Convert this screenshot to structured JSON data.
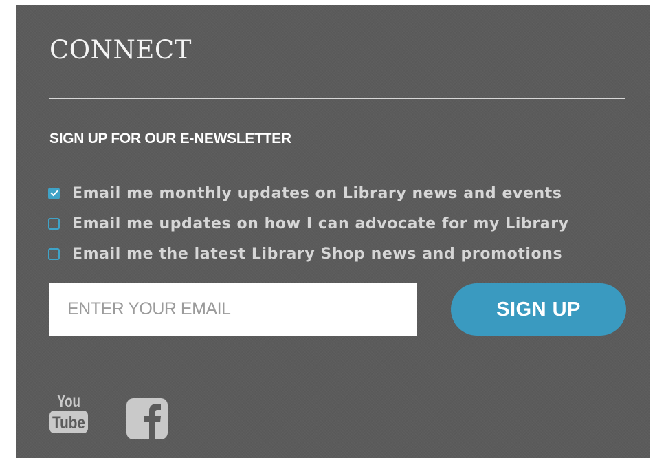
{
  "connect": {
    "heading": "CONNECT",
    "newsletter_title": "SIGN UP FOR OUR E-NEWSLETTER",
    "options": [
      {
        "label": "Email me monthly updates on Library news and events",
        "checked": true
      },
      {
        "label": "Email me updates on how I can advocate for my Library",
        "checked": false
      },
      {
        "label": "Email me the latest Library Shop news and promotions",
        "checked": false
      }
    ],
    "email": {
      "placeholder": "ENTER YOUR EMAIL",
      "value": ""
    },
    "signup_label": "SIGN UP"
  },
  "social": {
    "youtube": {
      "icon": "youtube-icon",
      "line1": "You",
      "line2": "Tube"
    },
    "facebook": {
      "icon": "facebook-icon",
      "glyph": "f"
    }
  },
  "colors": {
    "panel_bg": "#5b5b5b",
    "accent": "#3a9ac0",
    "checkbox": "#3fa3c7",
    "text": "#d6d6d6",
    "icon": "#c9c9c9"
  }
}
